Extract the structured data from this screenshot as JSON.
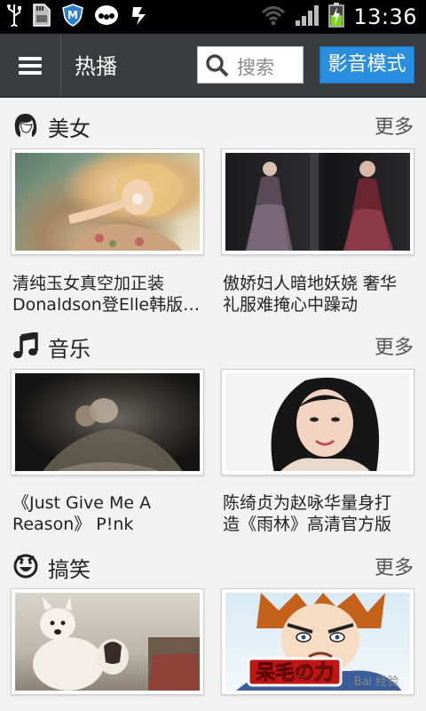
{
  "status_bar": {
    "time": "13:36",
    "left_icons": [
      "usb-icon",
      "sd-card-icon",
      "security-shield-icon",
      "pea-app-icon",
      "sync-icon"
    ],
    "right_icons": [
      "wifi-icon",
      "signal-icon",
      "battery-charging-icon"
    ]
  },
  "topbar": {
    "title": "热播",
    "search_placeholder": "搜索",
    "media_mode_label": "影音模式",
    "accent": "#2a8ee0"
  },
  "sections": [
    {
      "title": "美女",
      "icon": "beauty-face-icon",
      "more": "更多",
      "items": [
        {
          "caption": "清纯玉女真空加正装\nDonaldson登Elle韩版…"
        },
        {
          "caption": "傲娇妇人暗地妖娆 奢华\n礼服难掩心中躁动"
        }
      ]
    },
    {
      "title": "音乐",
      "icon": "music-note-icon",
      "more": "更多",
      "items": [
        {
          "caption": "《Just Give Me A\nReason》 P!nk"
        },
        {
          "caption": "陈绮贞为赵咏华量身打\n造《雨林》高清官方版"
        }
      ]
    },
    {
      "title": "搞笑",
      "icon": "funny-face-icon",
      "more": "更多",
      "items": [
        {
          "caption": "",
          "overlay_text": ""
        },
        {
          "caption": "",
          "overlay_text": "呆毛の力",
          "watermark": "Bai 经验"
        }
      ]
    }
  ]
}
